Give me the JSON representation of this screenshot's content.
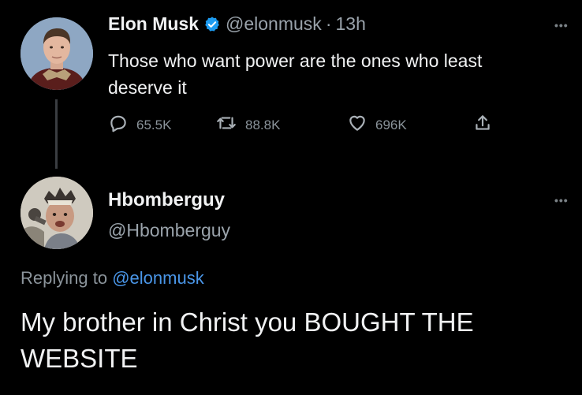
{
  "tweet": {
    "author_name": "Elon Musk",
    "author_handle": "@elonmusk",
    "separator": "·",
    "time": "13h",
    "text": "Those who want power are the ones who least deserve it",
    "replies": "65.5K",
    "retweets": "88.8K",
    "likes": "696K",
    "icons": {
      "reply": "speech-bubble-icon",
      "retweet": "retweet-arrows-icon",
      "like": "heart-icon",
      "share": "share-upload-icon",
      "verified": "verified-badge-icon",
      "more": "more-dots-icon"
    }
  },
  "reply": {
    "author_name": "Hbomberguy",
    "author_handle": "@Hbomberguy",
    "replying_prefix": "Replying to",
    "replying_to": "@elonmusk",
    "text": "My brother in Christ you BOUGHT THE WEBSITE"
  },
  "colors": {
    "background": "#000000",
    "text": "#e7e9ea",
    "muted": "#8b949b",
    "link": "#4a96e8",
    "verified": "#1d9bf0"
  }
}
